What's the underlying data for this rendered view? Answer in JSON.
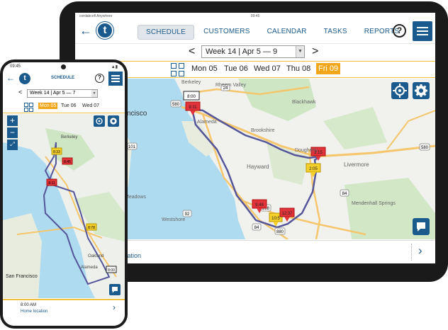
{
  "tablet": {
    "status_left": "cordabcofl Anywhere",
    "status_time": "09:45",
    "nav": {
      "tabs": [
        "SCHEDULE",
        "CUSTOMERS",
        "CALENDAR",
        "TASKS",
        "REPORTS"
      ],
      "active_tab": "SCHEDULE",
      "help": "?"
    },
    "week_select": "Week 14 | Apr 5 — 9",
    "days": [
      "Mon 05",
      "Tue 06",
      "Wed 07",
      "Thu 08",
      "Fri 09"
    ],
    "active_day": "Fri 09",
    "map": {
      "places": [
        "Berkeley",
        "Rheem Valley",
        "Blackhawk",
        "Brookshire",
        "Alameda",
        "Francisco",
        "Dougherty",
        "Livermore",
        "Hayward",
        "Meadows",
        "Westshore",
        "Mendenhall Springs"
      ],
      "route_stops": [
        "8:00",
        "8:11",
        "3:15",
        "2:05",
        "9:48",
        "10:5",
        "12:37"
      ],
      "highways": [
        "580",
        "24",
        "101",
        "92",
        "238",
        "84",
        "880",
        "84"
      ]
    },
    "bottom_location": "ocation"
  },
  "phone": {
    "status_time": "09:45",
    "title": "SCHEDULE",
    "help": "?",
    "week_select": "Week 14 | Apr 5 — 7",
    "days": [
      "Mon 05",
      "Tue 06",
      "Wed 07"
    ],
    "active_day": "Mon 05",
    "map": {
      "places": [
        "San Francisco",
        "Oakland",
        "Alameda",
        "Berkeley"
      ],
      "route_stops": [
        "8:33",
        "8:45",
        "8:11",
        "8:78",
        "8:00"
      ]
    },
    "bottom_time": "8:00 AM",
    "bottom_location": "Home location"
  },
  "colors": {
    "brand": "#1a5a8c",
    "accent": "#f2a71b",
    "route": "#55569a",
    "pin_red": "#e2333b",
    "pin_yellow": "#f5cf2a"
  }
}
